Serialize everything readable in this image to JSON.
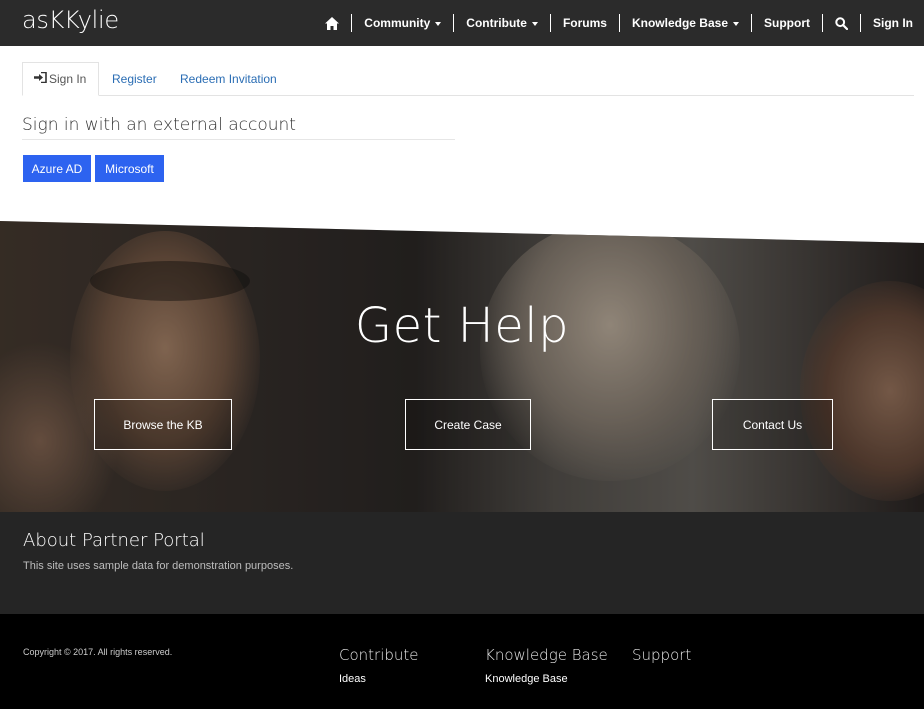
{
  "header": {
    "brand": "asKKylie",
    "nav": {
      "community": "Community",
      "contribute": "Contribute",
      "forums": "Forums",
      "knowledge_base": "Knowledge Base",
      "support": "Support",
      "sign_in": "Sign In"
    },
    "icons": {
      "home": "home-icon",
      "search": "search-icon"
    }
  },
  "tabs": {
    "sign_in": "Sign In",
    "register": "Register",
    "redeem": "Redeem Invitation"
  },
  "external": {
    "title": "Sign in with an external account",
    "azure_label": "Azure AD",
    "microsoft_label": "Microsoft"
  },
  "hero": {
    "title": "Get Help",
    "browse_label": "Browse the KB",
    "create_label": "Create Case",
    "contact_label": "Contact Us"
  },
  "about": {
    "title": "About Partner Portal",
    "text": "This site uses sample data for demonstration purposes."
  },
  "footer": {
    "copyright": "Copyright © 2017. All rights reserved.",
    "columns": [
      {
        "title": "Contribute",
        "link": "Ideas"
      },
      {
        "title": "Knowledge Base",
        "link": "Knowledge Base"
      },
      {
        "title": "Support"
      }
    ]
  },
  "colors": {
    "header_bg": "#2b2b2b",
    "button_blue": "#2d63f0",
    "link_blue": "#2a6db4",
    "about_bg": "#252525",
    "footer_bg": "#000000"
  }
}
